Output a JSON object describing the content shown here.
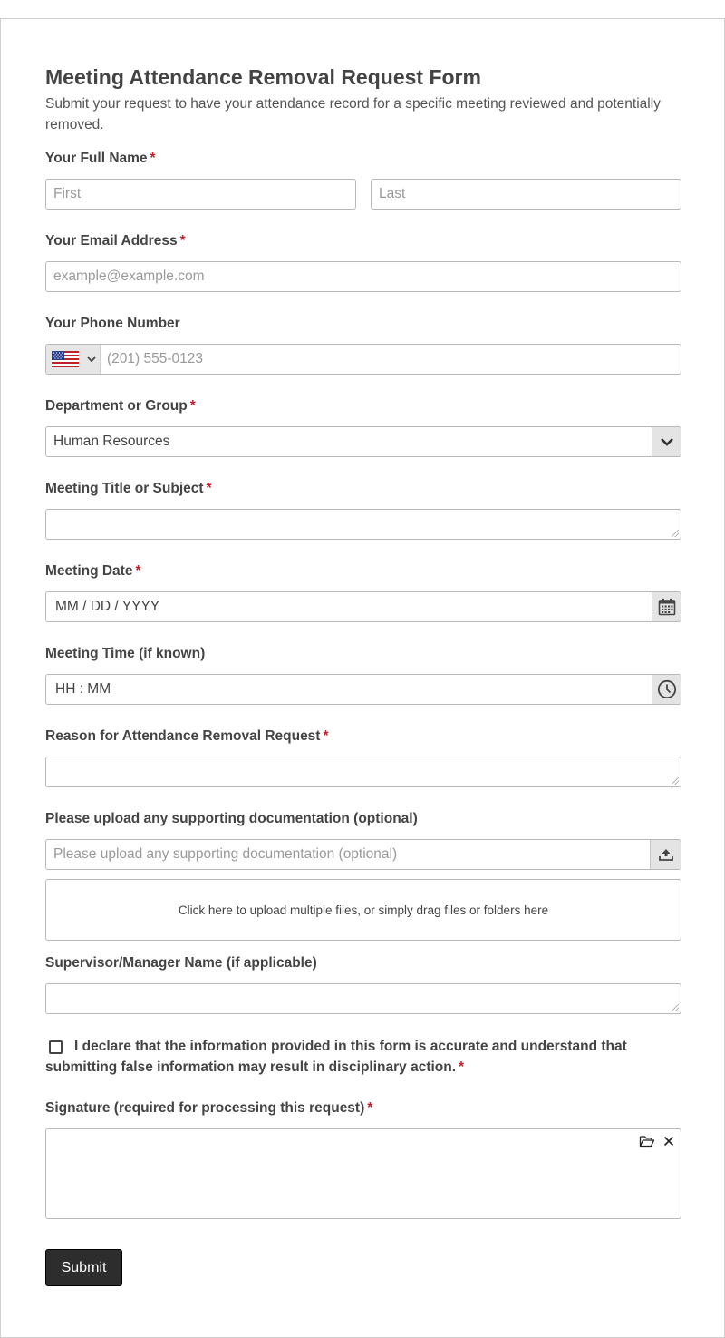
{
  "form": {
    "title": "Meeting Attendance Removal Request Form",
    "subtitle": "Submit your request to have your attendance record for a specific meeting reviewed and potentially removed.",
    "required_mark": "*"
  },
  "full_name": {
    "label": "Your Full Name",
    "first_placeholder": "First",
    "last_placeholder": "Last"
  },
  "email": {
    "label": "Your Email Address",
    "placeholder": "example@example.com"
  },
  "phone": {
    "label": "Your Phone Number",
    "placeholder": "(201) 555-0123",
    "country_icon": "us-flag-icon"
  },
  "department": {
    "label": "Department or Group",
    "value": "Human Resources"
  },
  "meeting_title": {
    "label": "Meeting Title or Subject",
    "value": ""
  },
  "meeting_date": {
    "label": "Meeting Date",
    "placeholder": "MM / DD / YYYY",
    "icon": "calendar-icon"
  },
  "meeting_time": {
    "label": "Meeting Time (if known)",
    "placeholder": "HH : MM",
    "icon": "clock-icon"
  },
  "reason": {
    "label": "Reason for Attendance Removal Request",
    "value": ""
  },
  "upload": {
    "label": "Please upload any supporting documentation (optional)",
    "placeholder": "Please upload any supporting documentation (optional)",
    "dropzone_text": "Click here to upload multiple files, or simply drag files or folders here",
    "icon": "upload-icon"
  },
  "supervisor": {
    "label": "Supervisor/Manager Name (if applicable)",
    "value": ""
  },
  "declaration": {
    "text": "I declare that the information provided in this form is accurate and understand that submitting false information may result in disciplinary action.",
    "checked": false
  },
  "signature": {
    "label": "Signature (required for processing this request)"
  },
  "submit_label": "Submit",
  "colors": {
    "required": "#c0212b",
    "submit_bg": "#2d2d2d",
    "border": "#b9b9b9"
  }
}
